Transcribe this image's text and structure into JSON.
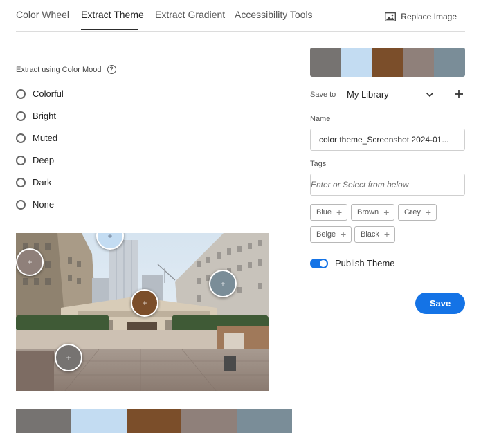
{
  "tabs": {
    "items": [
      {
        "label": "Color Wheel",
        "active": false
      },
      {
        "label": "Extract Theme",
        "active": true
      },
      {
        "label": "Extract Gradient",
        "active": false
      },
      {
        "label": "Accessibility Tools",
        "active": false
      }
    ],
    "replace_image": "Replace Image"
  },
  "mood": {
    "label": "Extract using Color Mood",
    "options": [
      "Colorful",
      "Bright",
      "Muted",
      "Deep",
      "Dark",
      "None"
    ]
  },
  "theme_colors": [
    "#767371",
    "#c3dcf2",
    "#7b4e2a",
    "#8f807a",
    "#7a8d98"
  ],
  "save_to": {
    "label": "Save to",
    "value": "My Library"
  },
  "name": {
    "label": "Name",
    "value": "color theme_Screenshot 2024-01..."
  },
  "tags": {
    "label": "Tags",
    "placeholder": "Enter or Select from below",
    "suggestions": [
      "Blue",
      "Brown",
      "Grey",
      "Beige",
      "Black"
    ]
  },
  "publish": {
    "label": "Publish Theme",
    "enabled": true
  },
  "save_button": "Save"
}
